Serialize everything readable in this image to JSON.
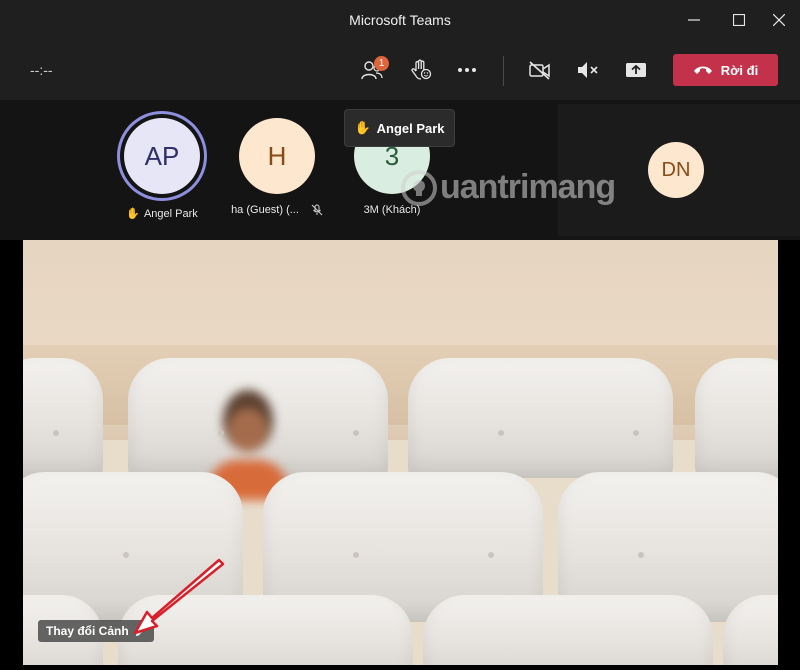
{
  "window": {
    "title": "Microsoft Teams",
    "controls": [
      "minimize-icon",
      "maximize-icon",
      "close-icon"
    ]
  },
  "toolbar": {
    "timer": "--:--",
    "people_badge": "1",
    "leave_label": "Rời đi",
    "leave_color": "#c4314b",
    "badge_color": "#e0643a",
    "icons": [
      "people-icon",
      "raise-hand-icon",
      "more-icon",
      "camera-off-icon",
      "mute-icon",
      "share-screen-icon",
      "hang-up-icon"
    ]
  },
  "participants": [
    {
      "initials": "AP",
      "name": "Angel Park",
      "hand_raised": true,
      "bg": "#e6e6f6",
      "fg": "#2f2f6a",
      "active_ring": "#8f8fe0"
    },
    {
      "initials": "H",
      "name": "ha (Guest) (...",
      "muted": true,
      "bg": "#fde7cf",
      "fg": "#8a4a16"
    },
    {
      "initials": "3",
      "name": "3M (Khách)",
      "bg": "#d9eee1",
      "fg": "#2b5a3c"
    }
  ],
  "hand_tooltip": {
    "name": "Angel Park"
  },
  "dn_tile": {
    "initials": "DN",
    "bg": "#fde7cf",
    "fg": "#8a4a16"
  },
  "watermark": "uantrimang",
  "video": {
    "scene_label": "Thay đổi Cảnh"
  }
}
